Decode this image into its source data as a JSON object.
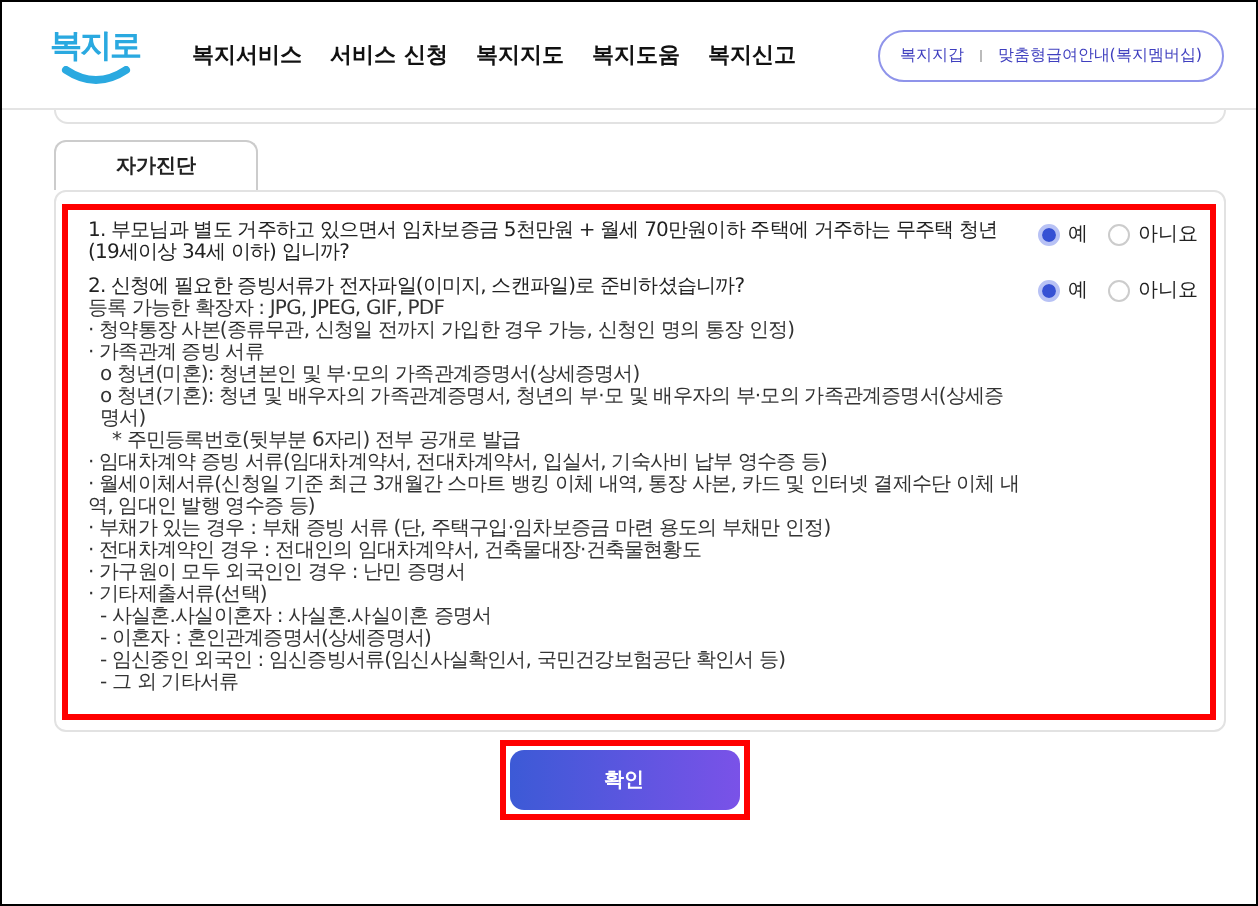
{
  "header": {
    "logo": "복지로",
    "nav": [
      "복지서비스",
      "서비스 신청",
      "복지지도",
      "복지도움",
      "복지신고"
    ],
    "quick_links": [
      "복지지갑",
      "맞춤형급여안내(복지멤버십)"
    ]
  },
  "tabs": [
    {
      "label": "자가진단",
      "selected": true
    }
  ],
  "questions": [
    {
      "text": "1. 부모님과 별도 거주하고 있으면서 임차보증금 5천만원 + 월세 70만원이하 주택에 거주하는 무주택 청년 (19세이상 34세 이하) 입니까?",
      "options": [
        {
          "label": "예",
          "selected": true
        },
        {
          "label": "아니요",
          "selected": false
        }
      ]
    },
    {
      "text": "2. 신청에 필요한 증빙서류가 전자파일(이미지, 스캔파일)로 준비하셨습니까?",
      "options": [
        {
          "label": "예",
          "selected": true
        },
        {
          "label": "아니요",
          "selected": false
        }
      ],
      "details": [
        {
          "text": "등록 가능한 확장자 : JPG, JPEG, GIF, PDF"
        },
        {
          "text": "· 청약통장 사본(종류무관, 신청일 전까지 가입한 경우 가능, 신청인 명의 통장 인정)"
        },
        {
          "text": "· 가족관계 증빙 서류",
          "children": [
            {
              "text": "o 청년(미혼): 청년본인 및 부·모의 가족관계증명서(상세증명서)"
            },
            {
              "text": "o 청년(기혼): 청년 및 배우자의 가족관계증명서, 청년의 부·모 및 배우자의 부·모의 가족관계증명서(상세증명서)",
              "children": [
                {
                  "text": "* 주민등록번호(뒷부분 6자리) 전부 공개로 발급"
                }
              ]
            }
          ]
        },
        {
          "text": "· 임대차계약 증빙 서류(임대차계약서, 전대차계약서, 입실서, 기숙사비 납부 영수증 등)"
        },
        {
          "text": "· 월세이체서류(신청일 기준 최근 3개월간 스마트 뱅킹 이체 내역, 통장 사본, 카드 및 인터넷 결제수단 이체 내역, 임대인 발행 영수증 등)"
        },
        {
          "text": "· 부채가 있는 경우 : 부채 증빙 서류 (단, 주택구입·임차보증금 마련 용도의 부채만 인정)"
        },
        {
          "text": "· 전대차계약인 경우 : 전대인의 임대차계약서, 건축물대장·건축물현황도"
        },
        {
          "text": "· 가구원이 모두 외국인인 경우 : 난민 증명서"
        },
        {
          "text": "· 기타제출서류(선택)",
          "children": [
            {
              "text": "- 사실혼.사실이혼자 : 사실혼.사실이혼 증명서"
            },
            {
              "text": "- 이혼자 : 혼인관계증명서(상세증명서)"
            },
            {
              "text": "- 임신중인 외국인 : 임신증빙서류(임신사실확인서, 국민건강보험공단 확인서 등)"
            },
            {
              "text": "- 그 외 기타서류"
            }
          ]
        }
      ]
    }
  ],
  "confirm_button": "확인"
}
